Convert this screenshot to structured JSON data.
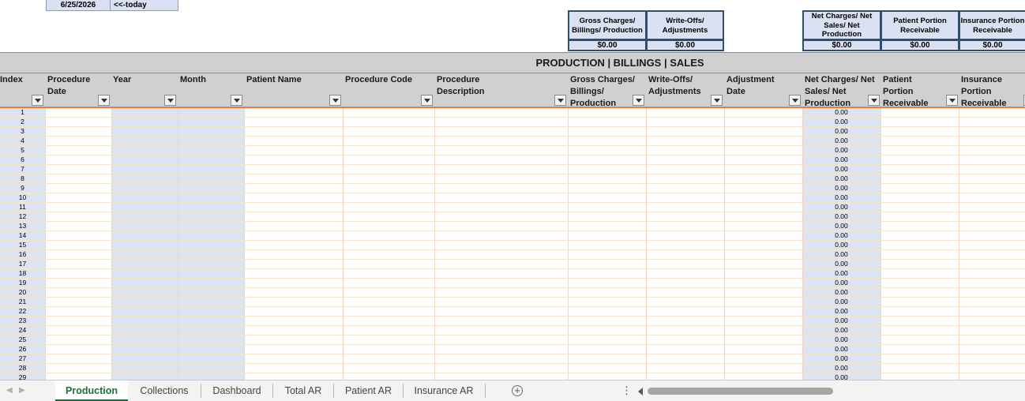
{
  "top": {
    "today_date": "6/25/2026",
    "today_label": "<<-today"
  },
  "summary": {
    "gross": {
      "label": "Gross Charges/ Billings/ Production",
      "value": "$0.00"
    },
    "writeoffs": {
      "label": "Write-Offs/ Adjustments",
      "value": "$0.00"
    },
    "net": {
      "label": "Net Charges/ Net Sales/ Net Production",
      "value": "$0.00"
    },
    "patient": {
      "label": "Patient Portion Receivable",
      "value": "$0.00"
    },
    "insurance": {
      "label": "Insurance Portion Receivable",
      "value": "$0.00"
    }
  },
  "section_title": "PRODUCTION | BILLINGS | SALES",
  "columns": [
    "Index",
    "Procedure Date",
    "Year",
    "Month",
    "Patient Name",
    "Procedure Code",
    "Procedure Description",
    "Gross Charges/ Billings/ Production",
    "Write-Offs/ Adjustments",
    "Adjustment Date",
    "Net Charges/ Net Sales/ Net Production",
    "Patient Portion Receivable",
    "Insurance Portion Receivable"
  ],
  "rows": {
    "index": [
      "1",
      "2",
      "3",
      "4",
      "5",
      "6",
      "7",
      "8",
      "9",
      "10",
      "11",
      "12",
      "13",
      "14",
      "15",
      "16",
      "17",
      "18",
      "19",
      "20",
      "21",
      "22",
      "23",
      "24",
      "25",
      "26",
      "27",
      "28",
      "29"
    ],
    "net_value": "0.00"
  },
  "tabs": [
    "Production",
    "Collections",
    "Dashboard",
    "Total AR",
    "Patient AR",
    "Insurance AR"
  ],
  "active_tab": "Production",
  "icons": {
    "add_sheet": "plus-circle-icon",
    "options": "vertical-dots-icon"
  },
  "colors": {
    "accent_green": "#1e6e3c",
    "header_blue": "#d9e1f2",
    "header_border": "#2f4f6f",
    "band_gray": "#d0d0d0",
    "orange_rule": "#e97f3c"
  }
}
